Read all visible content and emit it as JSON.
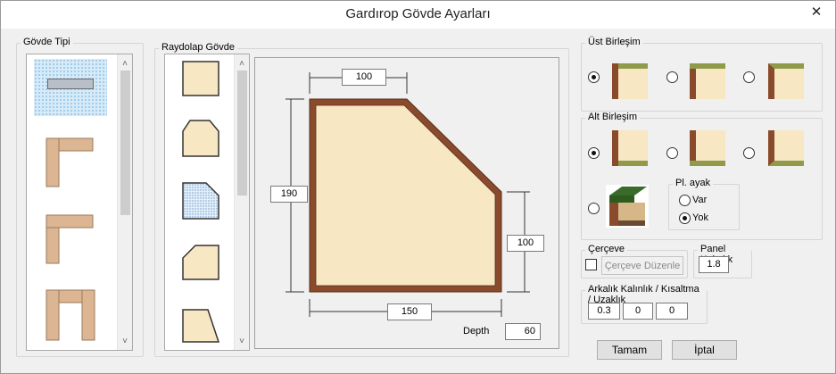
{
  "window": {
    "title": "Gardırop Gövde Ayarları",
    "close_glyph": "✕"
  },
  "govde_tipi": {
    "label": "Gövde Tipi"
  },
  "raydolap": {
    "label": "Raydolap Gövde"
  },
  "drawing": {
    "dim_top": "100",
    "dim_left": "190",
    "dim_right": "100",
    "dim_bottom": "150",
    "depth_label": "Depth",
    "depth_value": "60"
  },
  "ust_birlesim": {
    "label": "Üst Birleşim"
  },
  "alt_birlesim": {
    "label": "Alt Birleşim"
  },
  "pl_ayak": {
    "label": "Pl. ayak",
    "var_label": "Var",
    "yok_label": "Yok"
  },
  "cerceve": {
    "label": "Çerçeve",
    "button_label": "Çerçeve Düzenle"
  },
  "panel_kalinlik": {
    "label": "Panel Kalınlık",
    "value": "1.8"
  },
  "arkalik": {
    "label": "Arkalık Kalınlık / Kısaltma / Uzaklık",
    "v1": "0.3",
    "v2": "0",
    "v3": "0"
  },
  "buttons": {
    "ok": "Tamam",
    "cancel": "İptal"
  },
  "colors": {
    "wood_light": "#f7e7c3",
    "wood_dark": "#8a4b2d",
    "panel_tan": "#dcb592",
    "edge_olive": "#8f9a4a",
    "selection": "#cfe6f7"
  }
}
